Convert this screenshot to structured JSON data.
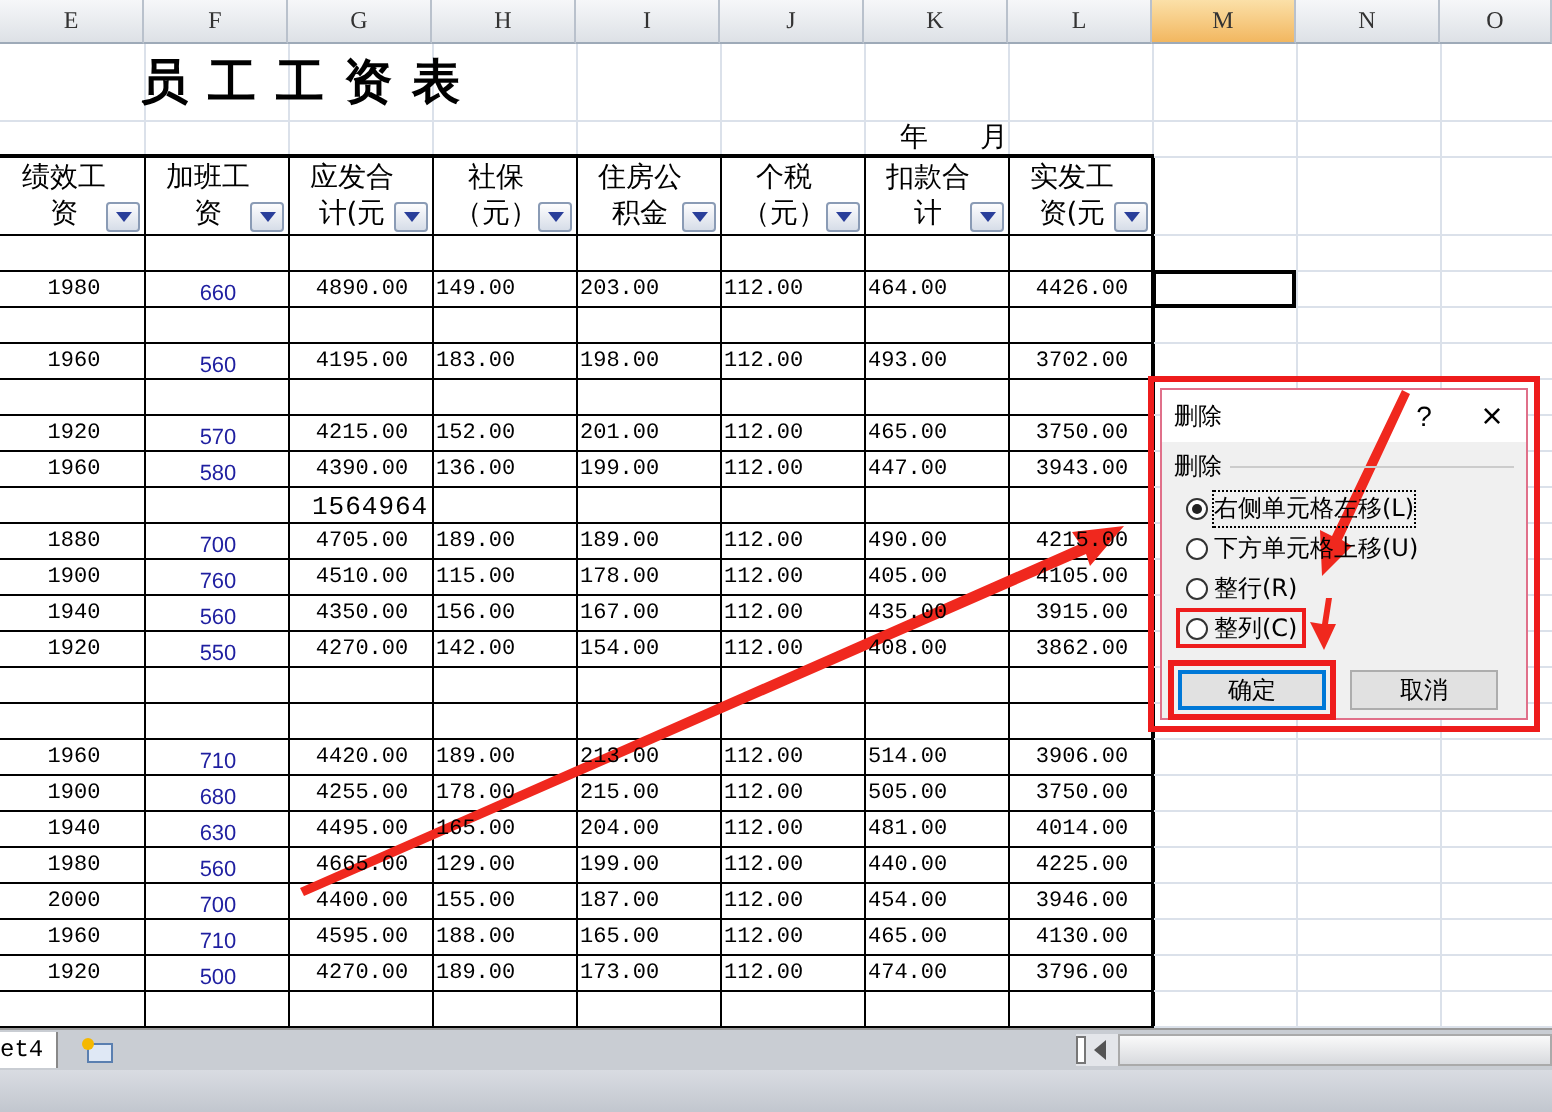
{
  "columns": [
    {
      "label": "E",
      "selected": false
    },
    {
      "label": "F",
      "selected": false
    },
    {
      "label": "G",
      "selected": false
    },
    {
      "label": "H",
      "selected": false
    },
    {
      "label": "I",
      "selected": false
    },
    {
      "label": "J",
      "selected": false
    },
    {
      "label": "K",
      "selected": false
    },
    {
      "label": "L",
      "selected": false
    },
    {
      "label": "M",
      "selected": true
    },
    {
      "label": "N",
      "selected": false
    },
    {
      "label": "O",
      "selected": false
    }
  ],
  "title": "员工工资表",
  "year_label": "年",
  "month_label": "月",
  "headers": [
    {
      "lines": [
        "绩效工",
        "资"
      ]
    },
    {
      "lines": [
        "加班工",
        "资"
      ]
    },
    {
      "lines": [
        "应发合",
        "计(元"
      ]
    },
    {
      "lines": [
        "社保",
        "（元）"
      ]
    },
    {
      "lines": [
        "住房公",
        "积金"
      ]
    },
    {
      "lines": [
        "个税",
        "（元）"
      ]
    },
    {
      "lines": [
        "扣款合",
        "计"
      ]
    },
    {
      "lines": [
        "实发工",
        "资(元"
      ]
    }
  ],
  "rows": [
    {
      "kind": "blank"
    },
    {
      "kind": "data",
      "cells": [
        "1980",
        "660",
        "4890.00",
        "149.00",
        "203.00",
        "112.00",
        "464.00",
        "4426.00"
      ],
      "cell_selected": true
    },
    {
      "kind": "blank"
    },
    {
      "kind": "data",
      "cells": [
        "1960",
        "560",
        "4195.00",
        "183.00",
        "198.00",
        "112.00",
        "493.00",
        "3702.00"
      ]
    },
    {
      "kind": "blank"
    },
    {
      "kind": "data",
      "cells": [
        "1920",
        "570",
        "4215.00",
        "152.00",
        "201.00",
        "112.00",
        "465.00",
        "3750.00"
      ]
    },
    {
      "kind": "data",
      "cells": [
        "1960",
        "580",
        "4390.00",
        "136.00",
        "199.00",
        "112.00",
        "447.00",
        "3943.00"
      ]
    },
    {
      "kind": "note",
      "text": "1564964"
    },
    {
      "kind": "data",
      "cells": [
        "1880",
        "700",
        "4705.00",
        "189.00",
        "189.00",
        "112.00",
        "490.00",
        "4215.00"
      ]
    },
    {
      "kind": "data",
      "cells": [
        "1900",
        "760",
        "4510.00",
        "115.00",
        "178.00",
        "112.00",
        "405.00",
        "4105.00"
      ]
    },
    {
      "kind": "data",
      "cells": [
        "1940",
        "560",
        "4350.00",
        "156.00",
        "167.00",
        "112.00",
        "435.00",
        "3915.00"
      ]
    },
    {
      "kind": "data",
      "cells": [
        "1920",
        "550",
        "4270.00",
        "142.00",
        "154.00",
        "112.00",
        "408.00",
        "3862.00"
      ]
    },
    {
      "kind": "blank"
    },
    {
      "kind": "blank"
    },
    {
      "kind": "data",
      "cells": [
        "1960",
        "710",
        "4420.00",
        "189.00",
        "213.00",
        "112.00",
        "514.00",
        "3906.00"
      ]
    },
    {
      "kind": "data",
      "cells": [
        "1900",
        "680",
        "4255.00",
        "178.00",
        "215.00",
        "112.00",
        "505.00",
        "3750.00"
      ]
    },
    {
      "kind": "data",
      "cells": [
        "1940",
        "630",
        "4495.00",
        "165.00",
        "204.00",
        "112.00",
        "481.00",
        "4014.00"
      ]
    },
    {
      "kind": "data",
      "cells": [
        "1980",
        "560",
        "4665.00",
        "129.00",
        "199.00",
        "112.00",
        "440.00",
        "4225.00"
      ]
    },
    {
      "kind": "data",
      "cells": [
        "2000",
        "700",
        "4400.00",
        "155.00",
        "187.00",
        "112.00",
        "454.00",
        "3946.00"
      ]
    },
    {
      "kind": "data",
      "cells": [
        "1960",
        "710",
        "4595.00",
        "188.00",
        "165.00",
        "112.00",
        "465.00",
        "4130.00"
      ]
    },
    {
      "kind": "data",
      "cells": [
        "1920",
        "500",
        "4270.00",
        "189.00",
        "173.00",
        "112.00",
        "474.00",
        "3796.00"
      ]
    },
    {
      "kind": "blank"
    }
  ],
  "sheet_tab": "et4",
  "dialog": {
    "title": "删除",
    "help": "?",
    "close": "×",
    "group_label": "删除",
    "annotated": true,
    "options": [
      {
        "label": "右侧单元格左移(L)",
        "selected": true,
        "annotated": false
      },
      {
        "label": "下方单元格上移(U)",
        "selected": false,
        "annotated": false
      },
      {
        "label": "整行(R)",
        "selected": false,
        "annotated": false
      },
      {
        "label": "整列(C)",
        "selected": false,
        "annotated": true
      }
    ],
    "buttons": [
      {
        "label": "确定",
        "focused": true,
        "annotated": true
      },
      {
        "label": "取消",
        "focused": false,
        "annotated": false
      }
    ]
  }
}
